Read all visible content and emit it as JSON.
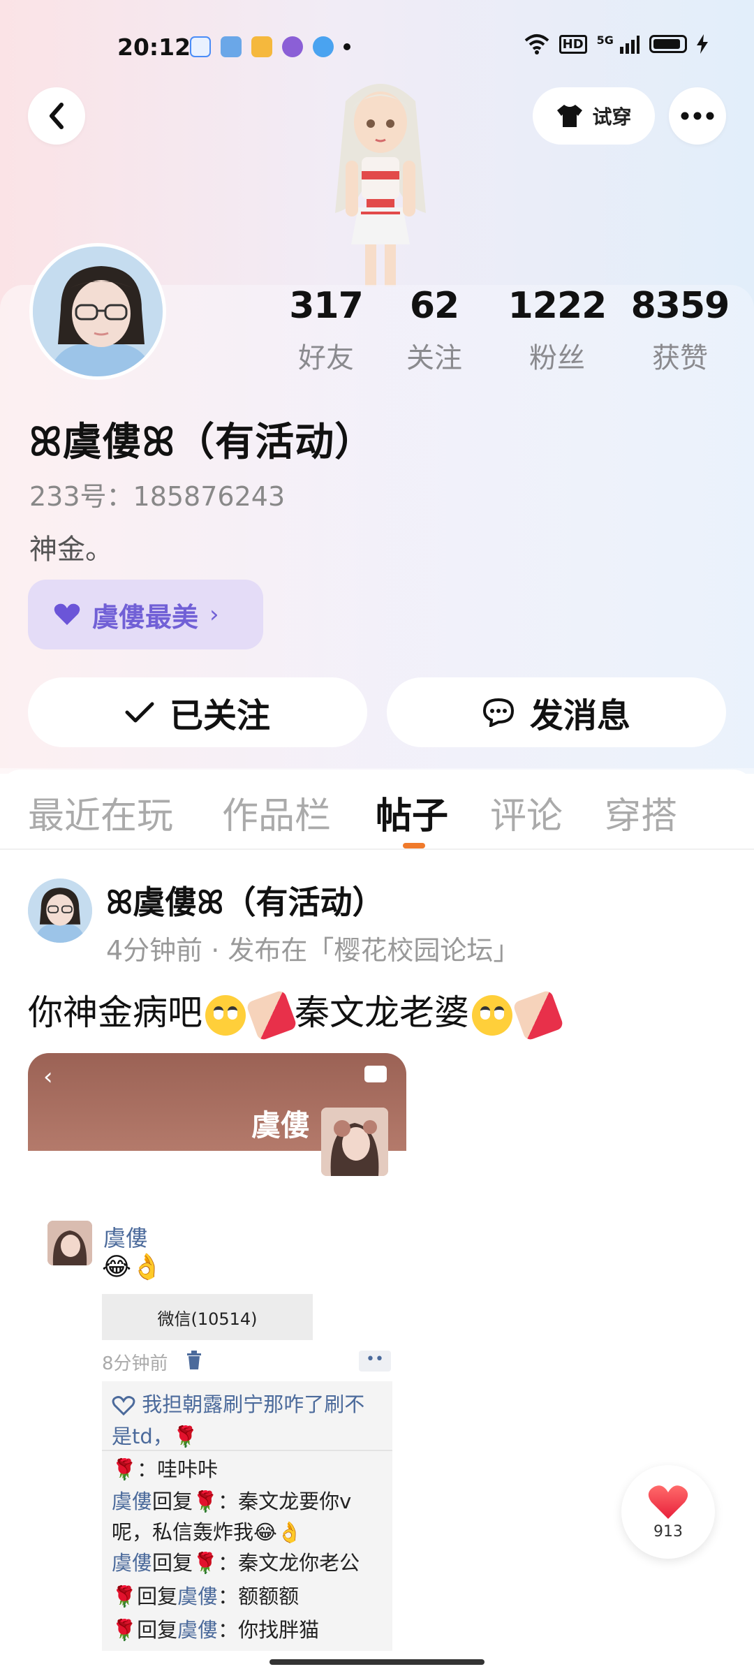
{
  "status_bar": {
    "time": "20:12",
    "icons": [
      "search-icon",
      "game-icon",
      "app-icon",
      "camera-app-icon",
      "baby-app-icon"
    ],
    "network": "5G"
  },
  "header": {
    "try_on_label": "试穿"
  },
  "stats": [
    {
      "value": "317",
      "label": "好友"
    },
    {
      "value": "62",
      "label": "关注"
    },
    {
      "value": "1222",
      "label": "粉丝"
    },
    {
      "value": "8359",
      "label": "获赞"
    }
  ],
  "profile": {
    "nickname": "ꕤ虞僂ꕤ（有活动）",
    "id_line": "233号：185876243",
    "bio": "神金。",
    "tag": "虞僂最美"
  },
  "actions": {
    "follow_label": "已关注",
    "message_label": "发消息"
  },
  "tabs": [
    {
      "label": "最近在玩",
      "active": false
    },
    {
      "label": "作品栏",
      "active": false
    },
    {
      "label": "帖子",
      "active": true
    },
    {
      "label": "评论",
      "active": false
    },
    {
      "label": "穿搭",
      "active": false
    }
  ],
  "post": {
    "author": "ꕤ虞僂ꕤ（有活动）",
    "meta": "4分钟前 · 发布在「樱花校园论坛」",
    "text_parts": [
      "你神金病吧",
      "秦文龙老婆"
    ],
    "screenshot": {
      "name": "虞僂",
      "comment": {
        "author": "虞僂",
        "emojis": "😂👌",
        "wechat_box": "微信(10514)",
        "time": "8分钟前",
        "more": "••",
        "like_line": "我担朝露刷宁那咋了刷不是td，🌹",
        "replies": [
          {
            "from": "🌹",
            "to": "",
            "text": "：哇咔咔"
          },
          {
            "from": "虞僂",
            "to": "🌹",
            "text": "：秦文龙要你v呢，私信轰炸我😂👌"
          },
          {
            "from": "虞僂",
            "to": "🌹",
            "text": "：秦文龙你老公"
          },
          {
            "from": "🌹",
            "to": "虞僂",
            "text": "：额额额"
          },
          {
            "from": "🌹",
            "to": "虞僂",
            "text": "：你找胖猫"
          }
        ],
        "reply_word": "回复"
      }
    }
  },
  "like_fab": {
    "count": "913"
  },
  "colors": {
    "accent_orange": "#f07a2b",
    "tag_purple": "#7160d6",
    "link_blue": "#4b6a9b",
    "heart_red": "#f23b4a"
  }
}
